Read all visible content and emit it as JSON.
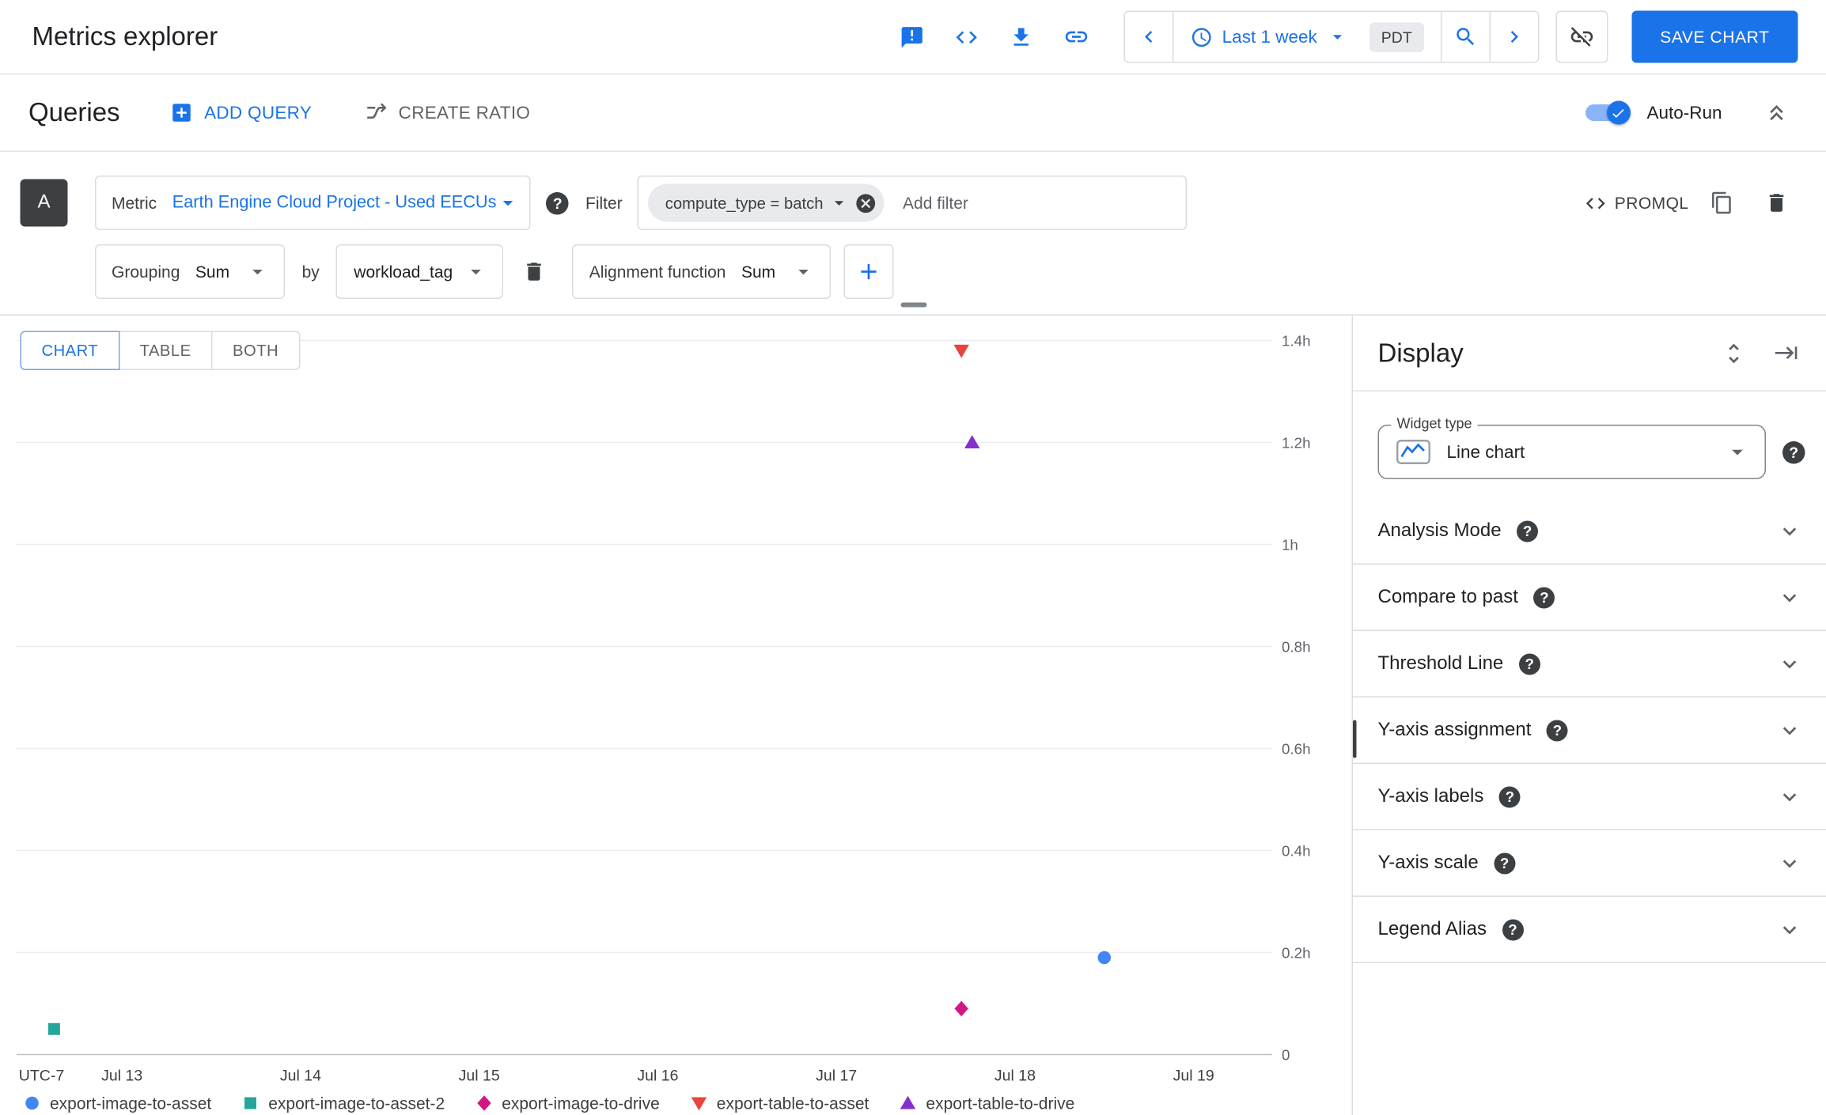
{
  "header": {
    "title": "Metrics explorer",
    "time_range": "Last 1 week",
    "timezone": "PDT",
    "save_button": "SAVE CHART"
  },
  "queries_bar": {
    "title": "Queries",
    "add_query": "ADD QUERY",
    "create_ratio": "CREATE RATIO",
    "auto_run": "Auto-Run"
  },
  "query": {
    "letter": "A",
    "metric_label": "Metric",
    "metric_value": "Earth Engine Cloud Project - Used EECUs",
    "filter_label": "Filter",
    "filter_chip": "compute_type = batch",
    "add_filter_placeholder": "Add filter",
    "promql": "PROMQL",
    "grouping_label": "Grouping",
    "grouping_value": "Sum",
    "by_label": "by",
    "grouping_by_value": "workload_tag",
    "alignment_label": "Alignment function",
    "alignment_value": "Sum"
  },
  "tabs": {
    "chart": "CHART",
    "table": "TABLE",
    "both": "BOTH"
  },
  "display": {
    "title": "Display",
    "widget_type_label": "Widget type",
    "widget_type_value": "Line chart",
    "sections": [
      "Analysis Mode",
      "Compare to past",
      "Threshold Line",
      "Y-axis assignment",
      "Y-axis labels",
      "Y-axis scale",
      "Legend Alias"
    ]
  },
  "icons": {
    "help_glyph": "?"
  },
  "colors": {
    "accent_blue": "#1a73e8",
    "series_blue": "#4285f4",
    "series_teal": "#26a69a",
    "series_magenta": "#d01884",
    "series_red": "#e8453c",
    "series_purple": "#8430ce"
  },
  "chart_data": {
    "type": "scatter",
    "title": "",
    "grid": "horizontal",
    "legend_position": "bottom",
    "x_axis": {
      "timezone_label": "UTC-7",
      "unit": "day of July",
      "range": [
        12.41,
        19.44
      ],
      "ticks": [
        {
          "value": 13,
          "label": "Jul 13"
        },
        {
          "value": 14,
          "label": "Jul 14"
        },
        {
          "value": 15,
          "label": "Jul 15"
        },
        {
          "value": 16,
          "label": "Jul 16"
        },
        {
          "value": 17,
          "label": "Jul 17"
        },
        {
          "value": 18,
          "label": "Jul 18"
        },
        {
          "value": 19,
          "label": "Jul 19"
        }
      ]
    },
    "y_axis": {
      "unit": "hours",
      "range": [
        0,
        1.45
      ],
      "ticks": [
        {
          "value": 1.4,
          "label": "1.4h"
        },
        {
          "value": 1.2,
          "label": "1.2h"
        },
        {
          "value": 1.0,
          "label": "1h"
        },
        {
          "value": 0.8,
          "label": "0.8h"
        },
        {
          "value": 0.6,
          "label": "0.6h"
        },
        {
          "value": 0.4,
          "label": "0.4h"
        },
        {
          "value": 0.2,
          "label": "0.2h"
        },
        {
          "value": 0,
          "label": "0"
        }
      ]
    },
    "series": [
      {
        "name": "export-image-to-asset",
        "marker": "circle",
        "color": "#4285f4",
        "points": [
          [
            18.5,
            0.19
          ]
        ]
      },
      {
        "name": "export-image-to-asset-2",
        "marker": "square",
        "color": "#26a69a",
        "points": [
          [
            12.62,
            0.05
          ]
        ]
      },
      {
        "name": "export-image-to-drive",
        "marker": "diamond",
        "color": "#d01884",
        "points": [
          [
            17.7,
            0.09
          ]
        ]
      },
      {
        "name": "export-table-to-asset",
        "marker": "triangle-down",
        "color": "#e8453c",
        "points": [
          [
            17.7,
            1.38
          ]
        ]
      },
      {
        "name": "export-table-to-drive",
        "marker": "triangle-up",
        "color": "#8430ce",
        "points": [
          [
            17.76,
            1.2
          ]
        ]
      }
    ]
  }
}
